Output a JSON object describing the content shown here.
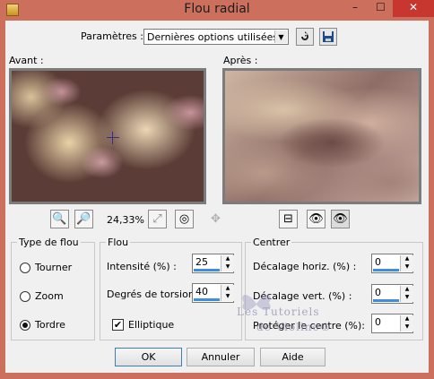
{
  "window": {
    "title": "Flou radial",
    "controls": {
      "minimize": "–",
      "maximize": "☐",
      "close": "✕"
    }
  },
  "presets": {
    "label": "Paramètres :",
    "value": "Dernières options utilisées",
    "reset_icon": "reset-icon",
    "save_icon": "save-icon"
  },
  "preview": {
    "before_label": "Avant :",
    "after_label": "Après :",
    "zoom": "24,33%"
  },
  "blur_type": {
    "title": "Type de flou",
    "options": [
      "Tourner",
      "Zoom",
      "Tordre"
    ],
    "selected": "Tordre"
  },
  "blur": {
    "title": "Flou",
    "intensity_label": "Intensité (%) :",
    "intensity": "25",
    "torsion_label": "Degrés de torsion :",
    "torsion": "40",
    "elliptic_label": "Elliptique",
    "elliptic_checked": true
  },
  "center": {
    "title": "Centrer",
    "h_offset_label": "Décalage horiz. (%) :",
    "h_offset": "0",
    "v_offset_label": "Décalage vert. (%) :",
    "v_offset": "0",
    "protect_label": "Protéger le centre (%):",
    "protect": "0"
  },
  "buttons": {
    "ok": "OK",
    "cancel": "Annuler",
    "help": "Aide"
  },
  "watermark": {
    "line1": "Les Tutoriels",
    "line2": "de Violine©"
  },
  "colors": {
    "titlebar": "#cc6f5d",
    "close": "#c7362f",
    "dialog": "#f0f0f0",
    "accent": "#3d8ee0"
  }
}
